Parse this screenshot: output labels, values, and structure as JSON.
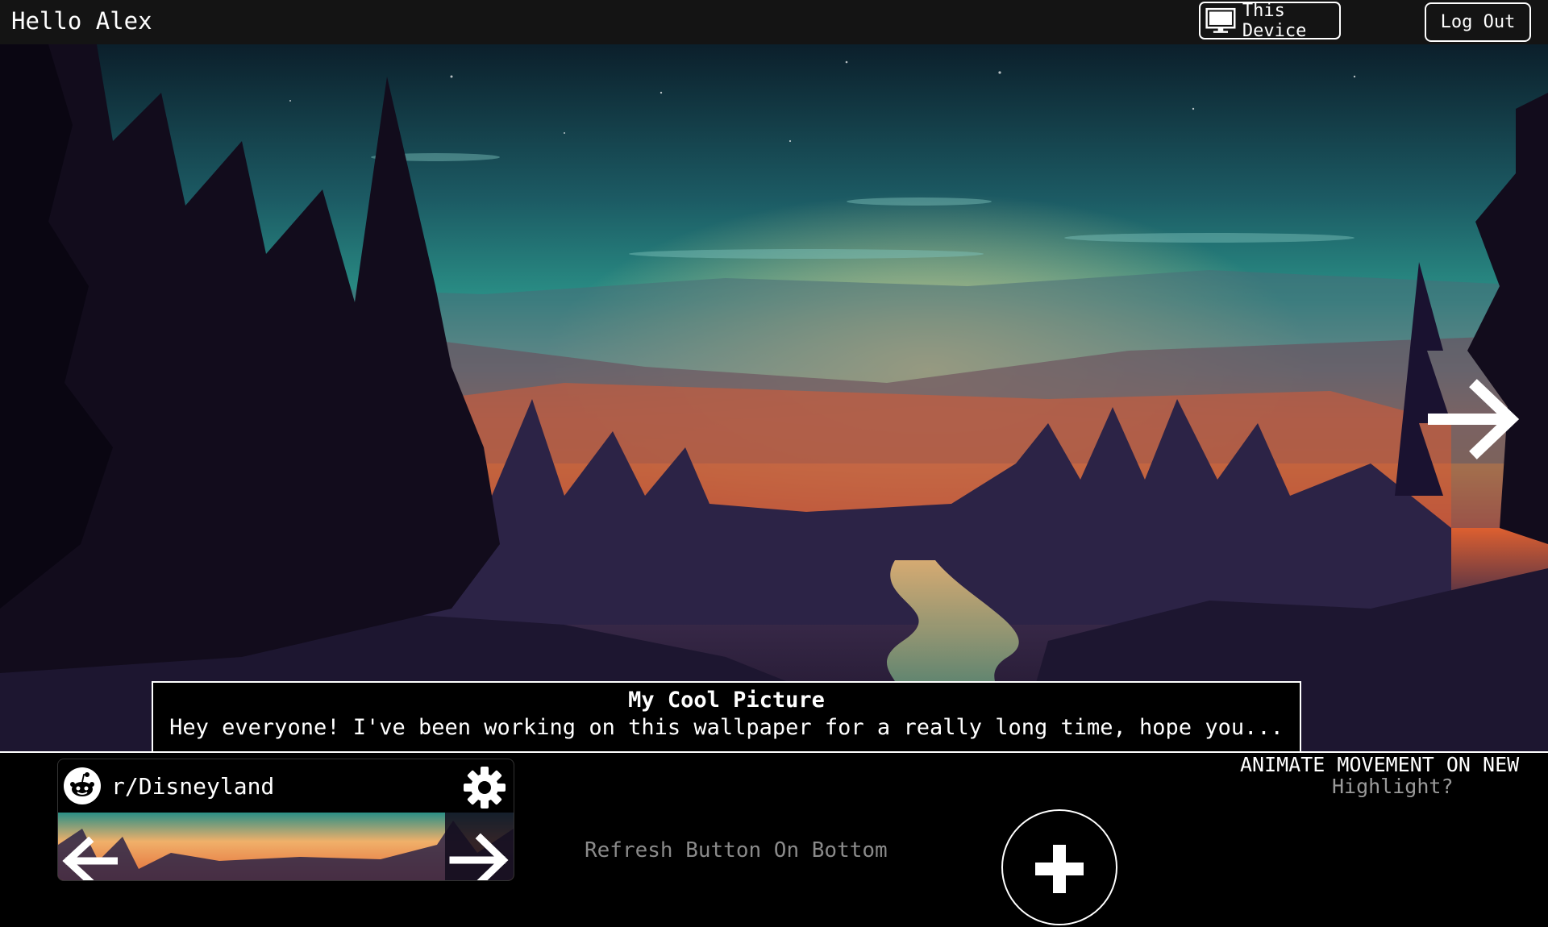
{
  "header": {
    "greeting": "Hello Alex",
    "device_label": "This Device",
    "device_icon": "monitor-icon",
    "logout_label": "Log Out"
  },
  "hero": {
    "description": "landscape wallpaper",
    "next_icon": "arrow-right-icon"
  },
  "caption": {
    "title": "My Cool Picture",
    "text": "Hey everyone! I've been working on this wallpaper for a really long time, hope you..."
  },
  "subreddit_card": {
    "name": "r/Disneyland",
    "icon": "reddit-icon",
    "settings_icon": "gear-icon",
    "prev_icon": "arrow-left-icon",
    "next_icon": "arrow-right-icon"
  },
  "bottom": {
    "refresh_hint": "Refresh Button On Bottom",
    "add_icon": "plus-icon",
    "animate_label": "ANIMATE MOVEMENT ON NEW",
    "highlight_label": "Highlight?"
  },
  "colors": {
    "topbar": "#141414",
    "sky_top": "#0c2530",
    "sky_teal": "#2a8f86",
    "sunset": "#f6a23a",
    "hint_gray": "#8a8a8a"
  }
}
